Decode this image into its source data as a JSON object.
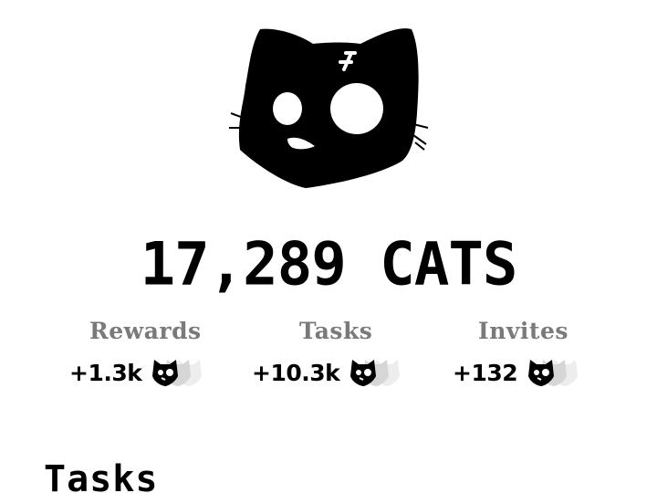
{
  "mascot": {
    "icon": "cat-face-icon"
  },
  "balance": {
    "amount": "17,289 CATS"
  },
  "stats": [
    {
      "label": "Rewards",
      "value": "+1.3k",
      "icon": "cat-stack-icon"
    },
    {
      "label": "Tasks",
      "value": "+10.3k",
      "icon": "cat-stack-icon"
    },
    {
      "label": "Invites",
      "value": "+132",
      "icon": "cat-stack-icon"
    }
  ],
  "sections": {
    "tasks_title": "Tasks"
  },
  "colors": {
    "text": "#000000",
    "muted": "#7a7a7a",
    "background": "#ffffff"
  }
}
